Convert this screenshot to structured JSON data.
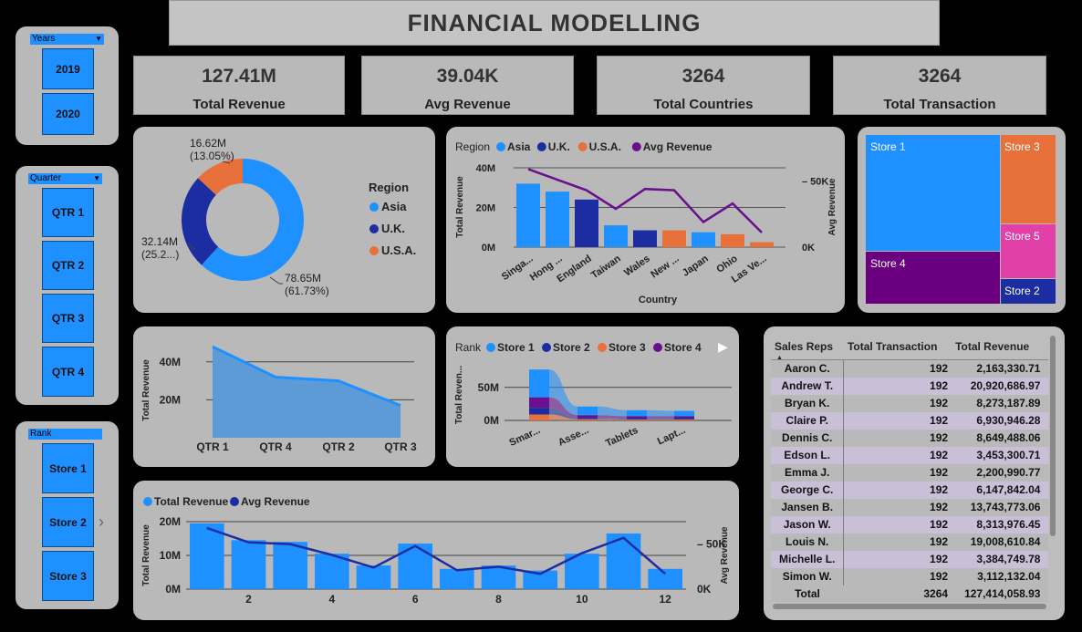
{
  "title": "FINANCIAL  MODELLING",
  "kpis": [
    {
      "value": "127.41M",
      "label": "Total Revenue"
    },
    {
      "value": "39.04K",
      "label": "Avg Revenue"
    },
    {
      "value": "3264",
      "label": "Total Countries"
    },
    {
      "value": "3264",
      "label": "Total Transaction"
    }
  ],
  "slicers": {
    "years": {
      "header": "Years",
      "items": [
        "2019",
        "2020"
      ]
    },
    "quarter": {
      "header": "Quarter",
      "items": [
        "QTR 1",
        "QTR 2",
        "QTR 3",
        "QTR 4"
      ]
    },
    "rank": {
      "header": "Rank",
      "items": [
        "Store 1",
        "Store 2",
        "Store 3"
      ]
    }
  },
  "colors": {
    "asia": "#1e90ff",
    "uk": "#1b2da0",
    "usa": "#e8703a",
    "avg": "#6a0f8e",
    "store4": "#6a0080",
    "store5": "#e040a8"
  },
  "chart_data": [
    {
      "id": "donut",
      "type": "pie",
      "legend_title": "Region",
      "categories": [
        "Asia",
        "U.K.",
        "U.S.A."
      ],
      "values": [
        78.65,
        32.14,
        16.62
      ],
      "labels": [
        "78.65M\n(61.73%)",
        "32.14M\n(25.2...)",
        "16.62M\n(13.05%)"
      ],
      "legend": "right"
    },
    {
      "id": "country",
      "type": "bar",
      "legend_title": "Region",
      "legend": [
        "Asia",
        "U.K.",
        "U.S.A.",
        "Avg Revenue"
      ],
      "categories": [
        "Singa...",
        "Hong ...",
        "England",
        "Taiwan",
        "Wales",
        "New ...",
        "Japan",
        "Ohio",
        "Las Ve..."
      ],
      "regions": [
        "Asia",
        "Asia",
        "U.K.",
        "Asia",
        "U.K.",
        "U.S.A.",
        "Asia",
        "U.S.A.",
        "U.S.A."
      ],
      "values": [
        32,
        28,
        24,
        11,
        8.5,
        8.5,
        7.5,
        6.5,
        2.5
      ],
      "avg_values": [
        59,
        51,
        43,
        29,
        44,
        43,
        19,
        33,
        11
      ],
      "xlabel": "Country",
      "ylabel": "Total Revenue",
      "y2label": "Avg Revenue",
      "yticks": [
        "0M",
        "20M",
        "40M"
      ],
      "y2ticks": [
        "0K",
        "50K"
      ],
      "ylim": [
        0,
        40
      ],
      "y2lim": [
        0,
        60
      ]
    },
    {
      "id": "quarter_area",
      "type": "area",
      "categories": [
        "QTR 1",
        "QTR 4",
        "QTR 2",
        "QTR 3"
      ],
      "values": [
        48,
        32,
        30,
        17
      ],
      "ylabel": "Total Revenue",
      "yticks": [
        "20M",
        "40M"
      ],
      "ylim": [
        0,
        50
      ]
    },
    {
      "id": "rank_ribbon",
      "type": "area",
      "legend_title": "Rank",
      "legend": [
        "Store 1",
        "Store 2",
        "Store 3",
        "Store 4"
      ],
      "categories": [
        "Smar...",
        "Asse...",
        "Tablets",
        "Lapt..."
      ],
      "ylabel": "Total Reven...",
      "yticks": [
        "0M",
        "50M"
      ],
      "series": [
        {
          "name": "Store 1",
          "values": [
            42,
            13,
            9,
            8
          ]
        },
        {
          "name": "Store 2",
          "values": [
            10,
            2,
            2,
            2
          ]
        },
        {
          "name": "Store 3",
          "values": [
            9,
            2,
            1.5,
            1.5
          ]
        },
        {
          "name": "Store 4",
          "values": [
            16,
            4,
            3,
            3
          ]
        }
      ]
    },
    {
      "id": "monthly",
      "type": "bar",
      "legend": [
        "Total Revenue",
        "Avg Revenue"
      ],
      "categories": [
        1,
        2,
        3,
        4,
        5,
        6,
        7,
        8,
        9,
        10,
        11,
        12
      ],
      "xticks": [
        "2",
        "4",
        "6",
        "8",
        "10",
        "12"
      ],
      "values": [
        19.5,
        14.5,
        14,
        10.5,
        7,
        13.5,
        6,
        7,
        5.5,
        10.5,
        16.5,
        6
      ],
      "avg_values": [
        68,
        52,
        50,
        38,
        24,
        48,
        21,
        25,
        17,
        40,
        57,
        17
      ],
      "ylabel": "Total Revenue",
      "y2label": "Avg Revenue",
      "yticks": [
        "0M",
        "10M",
        "20M"
      ],
      "y2ticks": [
        "0K",
        "50K"
      ],
      "ylim": [
        0,
        20
      ],
      "y2lim": [
        0,
        75
      ]
    }
  ],
  "treemap": [
    {
      "name": "Store 1"
    },
    {
      "name": "Store 3"
    },
    {
      "name": "Store 5"
    },
    {
      "name": "Store 4"
    },
    {
      "name": "Store 2"
    }
  ],
  "table": {
    "headers": [
      "Sales Reps",
      "Total Transaction",
      "Total Revenue",
      "A"
    ],
    "rows": [
      [
        "Aaron C.",
        "192",
        "2,163,330.71"
      ],
      [
        "Andrew T.",
        "192",
        "20,920,686.97"
      ],
      [
        "Bryan K.",
        "192",
        "8,273,187.89"
      ],
      [
        "Claire P.",
        "192",
        "6,930,946.28"
      ],
      [
        "Dennis C.",
        "192",
        "8,649,488.06"
      ],
      [
        "Edson L.",
        "192",
        "3,453,300.71"
      ],
      [
        "Emma J.",
        "192",
        "2,200,990.77"
      ],
      [
        "George C.",
        "192",
        "6,147,842.04"
      ],
      [
        "Jansen B.",
        "192",
        "13,743,773.06"
      ],
      [
        "Jason W.",
        "192",
        "8,313,976.45"
      ],
      [
        "Louis N.",
        "192",
        "19,008,610.84"
      ],
      [
        "Michelle L.",
        "192",
        "3,384,749.78"
      ],
      [
        "Simon W.",
        "192",
        "3,112,132.04"
      ]
    ],
    "total": [
      "Total",
      "3264",
      "127,414,058.93"
    ]
  }
}
